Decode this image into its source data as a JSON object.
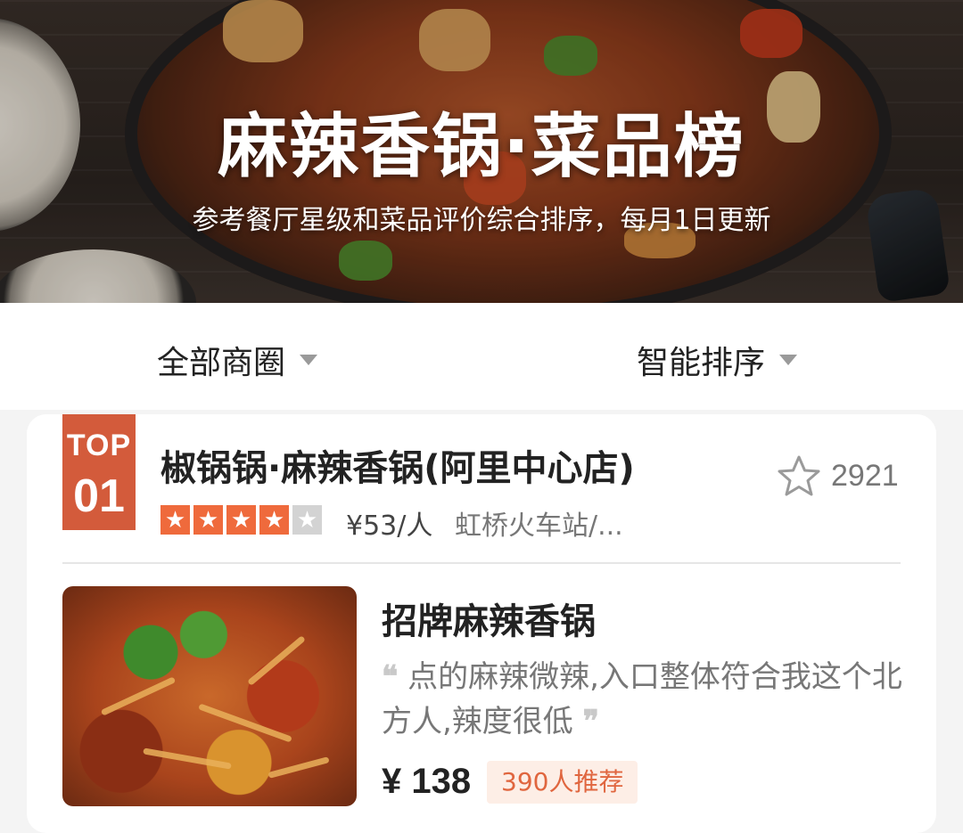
{
  "header": {
    "title": "麻辣香锅·菜品榜",
    "subtitle": "参考餐厅星级和菜品评价综合排序，每月1日更新"
  },
  "filters": {
    "area_label": "全部商圈",
    "sort_label": "智能排序"
  },
  "card": {
    "badge_top": "TOP",
    "badge_rank": "01",
    "shop_name": "椒锅锅·麻辣香锅(阿里中心店)",
    "rating_stars": 4,
    "rating_max": 5,
    "price_per_person": "¥53/人",
    "location": "虹桥火车站/...",
    "favorite_count": "2921",
    "dish": {
      "name": "招牌麻辣香锅",
      "review_open_quote": "❝",
      "review_text": "点的麻辣微辣,入口整体符合我这个北方人,辣度很低",
      "review_close_quote": "❞",
      "price": "¥ 138",
      "recommend": "390人推荐"
    }
  },
  "icons": {
    "favorite": "star-outline-icon",
    "dropdown": "caret-down-icon"
  },
  "colors": {
    "accent": "#d35b3b",
    "star": "#ef6a3c",
    "recommend_bg": "#fdeee6",
    "recommend_text": "#e0663f"
  }
}
